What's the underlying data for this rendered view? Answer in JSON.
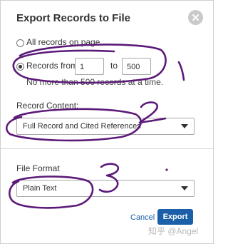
{
  "dialog": {
    "title": "Export Records to File"
  },
  "record_range": {
    "all_label": "All records on page",
    "from_label": "Records from:",
    "from_value": "1",
    "to_label": "to",
    "to_value": "500",
    "note": "No more than 500 records at a time."
  },
  "record_content": {
    "label": "Record Content:",
    "selected": "Full Record and Cited References"
  },
  "file_format": {
    "label": "File Format",
    "selected": "Plain Text"
  },
  "actions": {
    "cancel_label": "Cancel",
    "export_label": "Export"
  },
  "watermark": "知乎 @Angel",
  "annotations": [
    "1",
    "2",
    "3"
  ],
  "colors": {
    "ink": "#5c1a78",
    "primary": "#1a5fa8"
  }
}
